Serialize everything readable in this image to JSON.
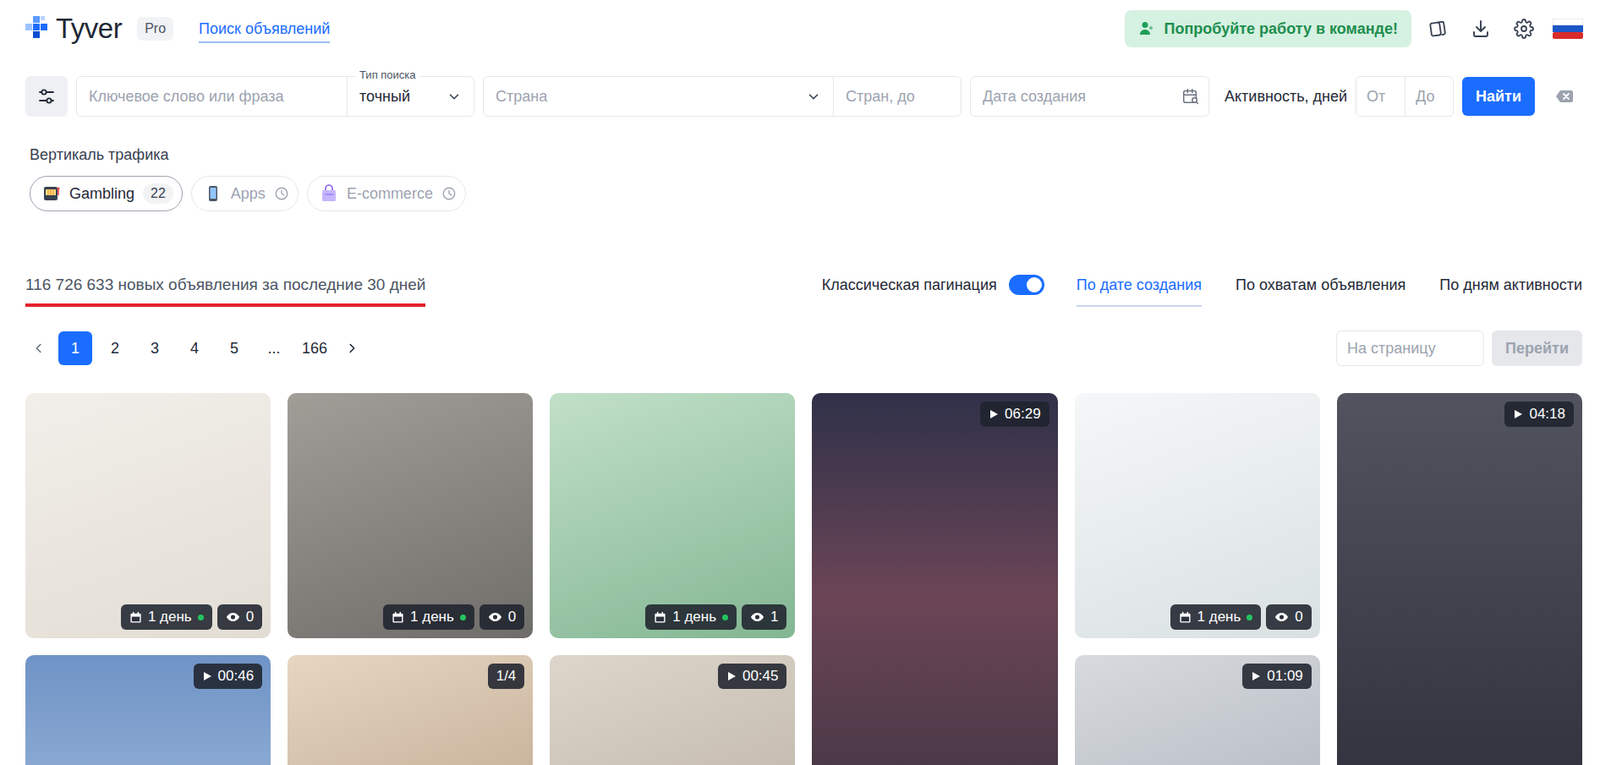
{
  "header": {
    "logo": {
      "text": "Tyver",
      "badge": "Pro"
    },
    "nav": [
      {
        "label": "Поиск объявлений",
        "selected": true
      }
    ],
    "team_button": "Попробуйте работу в команде!"
  },
  "filters": {
    "keyword": {
      "placeholder": "Ключевое слово или фраза"
    },
    "search_type": {
      "label": "Тип поиска",
      "value": "точный"
    },
    "country": {
      "placeholder": "Страна"
    },
    "countries_max": {
      "placeholder": "Стран, до"
    },
    "created": {
      "placeholder": "Дата создания"
    },
    "activity": {
      "label": "Активность, дней",
      "from": "От",
      "to": "До"
    },
    "submit": "Найти"
  },
  "verticals": {
    "title": "Вертикаль трафика",
    "items": [
      {
        "label": "Gambling",
        "count": "22",
        "disabled": false
      },
      {
        "label": "Apps",
        "disabled": true
      },
      {
        "label": "E-commerce",
        "disabled": true
      }
    ]
  },
  "summary": "116 726 633 новых объявления за последние 30 дней",
  "pagination_toggle": {
    "label": "Классическая пагинация",
    "on": true
  },
  "sort_tabs": [
    {
      "label": "По дате создания",
      "selected": true
    },
    {
      "label": "По охватам объявления",
      "selected": false
    },
    {
      "label": "По дням активности",
      "selected": false
    }
  ],
  "pagination": {
    "pages": [
      {
        "label": "1",
        "selected": true
      },
      {
        "label": "2",
        "selected": false
      },
      {
        "label": "3",
        "selected": false
      },
      {
        "label": "4",
        "selected": false
      },
      {
        "label": "5",
        "selected": false
      },
      {
        "label": "...",
        "selected": false
      },
      {
        "label": "166",
        "selected": false
      }
    ],
    "goto": {
      "placeholder": "На страницу",
      "button": "Перейти",
      "button_disabled": true
    }
  },
  "feed": {
    "columns": [
      [
        {
          "kind": "image",
          "age": "1 день",
          "active": true,
          "views": "0"
        },
        {
          "kind": "video",
          "duration": "00:46"
        }
      ],
      [
        {
          "kind": "image",
          "age": "1 день",
          "active": true,
          "views": "0"
        },
        {
          "kind": "carousel",
          "slides": "1/4"
        }
      ],
      [
        {
          "kind": "image",
          "age": "1 день",
          "active": true,
          "views": "1"
        },
        {
          "kind": "video",
          "duration": "00:45"
        }
      ],
      [
        {
          "kind": "vertical-video",
          "duration": "06:29"
        }
      ],
      [
        {
          "kind": "image",
          "age": "1 день",
          "active": true,
          "views": "0"
        },
        {
          "kind": "video",
          "duration": "01:09"
        }
      ],
      [
        {
          "kind": "vertical-video",
          "duration": "04:18"
        }
      ]
    ]
  }
}
